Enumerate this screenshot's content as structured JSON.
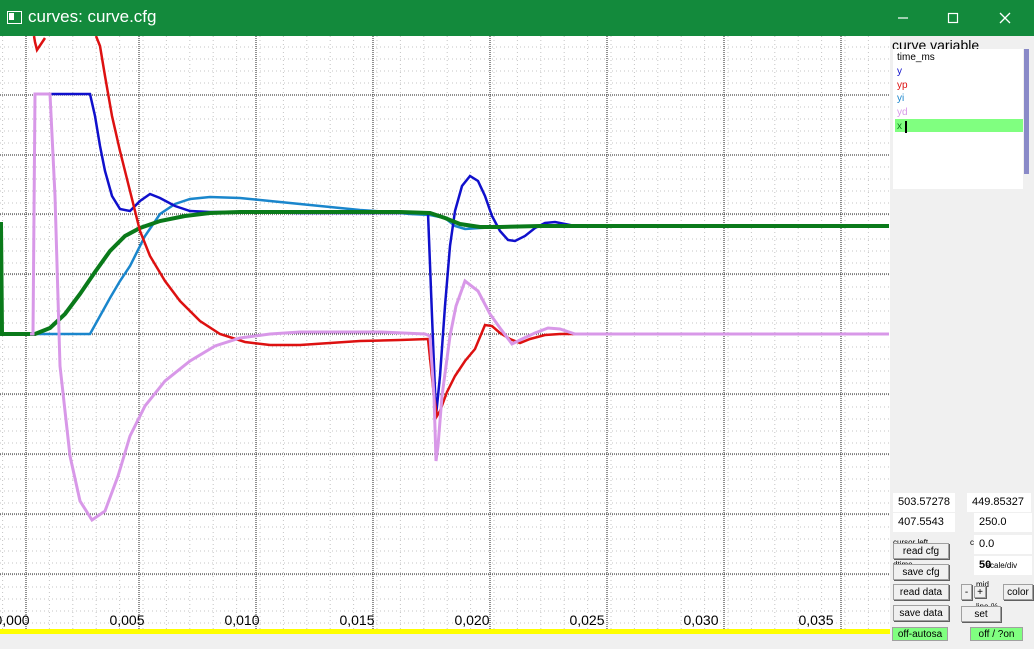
{
  "window": {
    "title": "curves: curve.cfg",
    "minimize_icon": "minimize-icon",
    "maximize_icon": "maximize-icon",
    "close_icon": "close-icon"
  },
  "plot": {
    "x_tick_labels": [
      "0,000",
      "0,005",
      "0,010",
      "0,015",
      "0,020",
      "0,025",
      "0,030",
      "0,035"
    ],
    "colors": {
      "y": "#1010cc",
      "yp": "#dd1111",
      "yi": "#1a86cc",
      "yd": "#d898e8",
      "x": "#0a7a1a",
      "grid_major": "#000000",
      "grid_minor": "#bcbcbc",
      "bottom_bar": "#ffff00"
    }
  },
  "panel": {
    "list_title": "curve variable",
    "curves": [
      {
        "name": "time_ms",
        "color": "#000000"
      },
      {
        "name": "y",
        "color": "#1010cc"
      },
      {
        "name": "yp",
        "color": "#dd1111"
      },
      {
        "name": "yi",
        "color": "#1a86cc"
      },
      {
        "name": "yd",
        "color": "#d898e8"
      },
      {
        "name": "x",
        "color": "#0a7a1a"
      }
    ],
    "value_1": "503.57278",
    "value_2": "449.85327",
    "value_3": "407.5543",
    "value_4": "250.0",
    "cursor_left_label": "cursor left",
    "cu_label": "cu",
    "value_5": "0.0",
    "read_cfg": "read cfg",
    "dtime_label": "dtime",
    "save_cfg": "save cfg",
    "scale_label": "scale/div",
    "value_6": "50",
    "read_data": "read data",
    "minus": "-",
    "mid_label": "mid",
    "plus": "+",
    "color": "color",
    "save_data": "save data",
    "line_label": "line-%",
    "set": "set",
    "off_autosave": "off-autosa",
    "off_on": "off / ?on"
  }
}
